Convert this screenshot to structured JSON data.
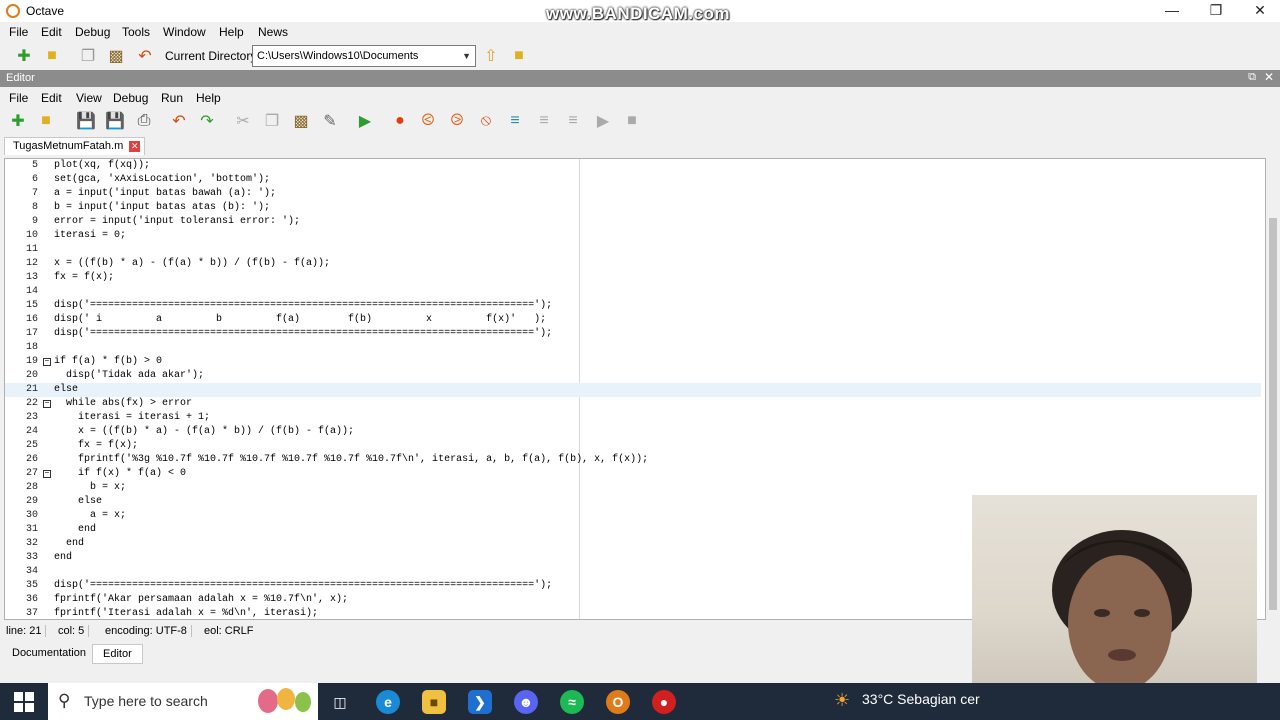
{
  "window": {
    "title": "Octave",
    "watermark": "www.BANDICAM.com"
  },
  "main_menu": [
    "File",
    "Edit",
    "Debug",
    "Tools",
    "Window",
    "Help",
    "News"
  ],
  "current_directory": {
    "label": "Current Directory:",
    "value": "C:\\Users\\Windows10\\Documents"
  },
  "editor": {
    "panel_title": "Editor",
    "menu": [
      "File",
      "Edit",
      "View",
      "Debug",
      "Run",
      "Help"
    ],
    "file_tab": "TugasMetnumFatah.m",
    "lines": [
      {
        "n": "5",
        "text": "plot(xq, f(xq));"
      },
      {
        "n": "6",
        "text": "set(gca, 'xAxisLocation', 'bottom');"
      },
      {
        "n": "7",
        "text": "a = input('input batas bawah (a): ');"
      },
      {
        "n": "8",
        "text": "b = input('input batas atas (b): ');"
      },
      {
        "n": "9",
        "text": "error = input('input toleransi error: ');"
      },
      {
        "n": "10",
        "text": "iterasi = 0;"
      },
      {
        "n": "11",
        "text": ""
      },
      {
        "n": "12",
        "text": "x = ((f(b) * a) - (f(a) * b)) / (f(b) - f(a));"
      },
      {
        "n": "13",
        "text": "fx = f(x);"
      },
      {
        "n": "14",
        "text": ""
      },
      {
        "n": "15",
        "text": "disp('==========================================================================');"
      },
      {
        "n": "16",
        "text": "disp(' i         a         b         f(a)        f(b)         x         f(x)'   );"
      },
      {
        "n": "17",
        "text": "disp('==========================================================================');"
      },
      {
        "n": "18",
        "text": ""
      },
      {
        "n": "19",
        "text": "if f(a) * f(b) > 0"
      },
      {
        "n": "20",
        "text": "  disp('Tidak ada akar');"
      },
      {
        "n": "21",
        "text": "else"
      },
      {
        "n": "22",
        "text": "  while abs(fx) > error"
      },
      {
        "n": "23",
        "text": "    iterasi = iterasi + 1;"
      },
      {
        "n": "24",
        "text": "    x = ((f(b) * a) - (f(a) * b)) / (f(b) - f(a));"
      },
      {
        "n": "25",
        "text": "    fx = f(x);"
      },
      {
        "n": "26",
        "text": "    fprintf('%3g %10.7f %10.7f %10.7f %10.7f %10.7f %10.7f\\n', iterasi, a, b, f(a), f(b), x, f(x));"
      },
      {
        "n": "27",
        "text": "    if f(x) * f(a) < 0"
      },
      {
        "n": "28",
        "text": "      b = x;"
      },
      {
        "n": "29",
        "text": "    else"
      },
      {
        "n": "30",
        "text": "      a = x;"
      },
      {
        "n": "31",
        "text": "    end"
      },
      {
        "n": "32",
        "text": "  end"
      },
      {
        "n": "33",
        "text": "end"
      },
      {
        "n": "34",
        "text": ""
      },
      {
        "n": "35",
        "text": "disp('==========================================================================');"
      },
      {
        "n": "36",
        "text": "fprintf('Akar persamaan adalah x = %10.7f\\n', x);"
      },
      {
        "n": "37",
        "text": "fprintf('Iterasi adalah x = %d\\n', iterasi);"
      }
    ]
  },
  "status": {
    "line": "line: 21",
    "col": "col: 5",
    "encoding": "encoding: UTF-8",
    "eol": "eol: CRLF"
  },
  "bottom_tabs": [
    "Documentation",
    "Editor"
  ],
  "taskbar": {
    "search_placeholder": "Type here to search",
    "weather": "33°C  Sebagian cer"
  },
  "colors": {
    "string": "#7a2c8e",
    "keyword": "#0000b0",
    "number": "#b07a00",
    "accent": "#2d7d2d"
  }
}
